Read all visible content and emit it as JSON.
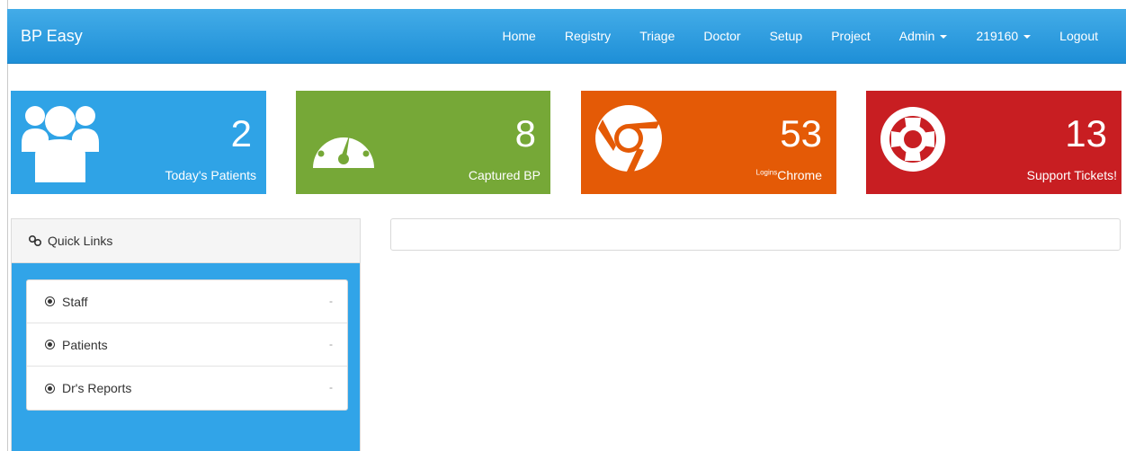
{
  "app": {
    "brand": "BP Easy"
  },
  "nav": {
    "home": "Home",
    "registry": "Registry",
    "triage": "Triage",
    "doctor": "Doctor",
    "setup": "Setup",
    "project": "Project",
    "admin": "Admin",
    "user": "219160",
    "logout": "Logout"
  },
  "tiles": {
    "patients": {
      "value": "2",
      "label": "Today's Patients",
      "color": "#2fa3e6",
      "icon": "users-icon"
    },
    "bp": {
      "value": "8",
      "label": "Captured BP",
      "color": "#76a837",
      "icon": "gauge-icon"
    },
    "chrome": {
      "value": "53",
      "label_sup": "Logins",
      "label": "Chrome",
      "color": "#e45a06",
      "icon": "chrome-icon"
    },
    "tickets": {
      "value": "13",
      "label": "Support Tickets!",
      "color": "#c81e22",
      "icon": "lifebuoy-icon"
    }
  },
  "quick_links": {
    "title": "Quick Links",
    "items": [
      {
        "label": "Staff",
        "marker": "-"
      },
      {
        "label": "Patients",
        "marker": "-"
      },
      {
        "label": "Dr's Reports",
        "marker": "-"
      }
    ]
  }
}
